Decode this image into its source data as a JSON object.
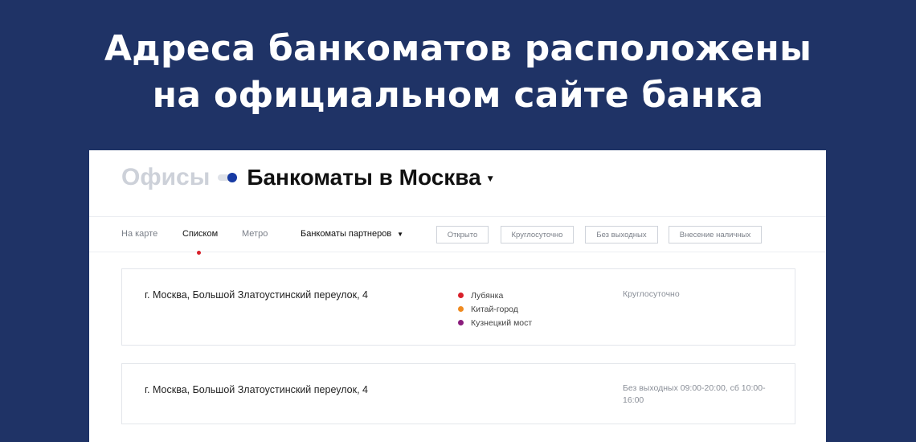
{
  "banner": {
    "line1": "Адреса банкоматов расположены",
    "line2": "на официальном сайте банка"
  },
  "header": {
    "offices": "Офисы",
    "atms_title": "Банкоматы в Москва",
    "caret_icon": "chevron-down-icon"
  },
  "nav": {
    "on_map": "На карте",
    "list": "Списком",
    "metro": "Метро",
    "partners": "Банкоматы партнеров",
    "active": "Списком"
  },
  "filters": [
    "Открыто",
    "Круглосуточно",
    "Без выходных",
    "Внесение наличных"
  ],
  "atms": [
    {
      "address": "г. Москва, Большой Златоустинский переулок, 4",
      "metro": [
        {
          "name": "Лубянка",
          "color": "#d8202a"
        },
        {
          "name": "Китай-город",
          "color": "#ef8a1f"
        },
        {
          "name": "Кузнецкий мост",
          "color": "#8a1c7c"
        }
      ],
      "hours": "Круглосуточно"
    },
    {
      "address": "г. Москва, Большой Златоустинский переулок, 4",
      "metro": [],
      "hours": "Без выходных 09:00-20:00, сб 10:00-16:00"
    }
  ],
  "colors": {
    "background": "#1f3366",
    "accent": "#173aa3",
    "active_marker": "#d8202a"
  }
}
